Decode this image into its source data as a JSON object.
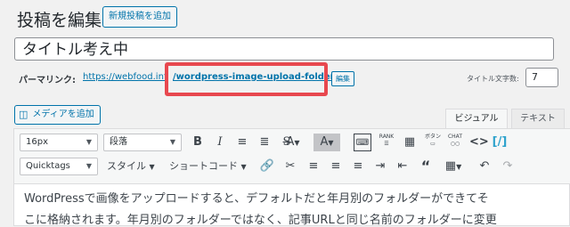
{
  "header": {
    "title": "投稿を編集",
    "add_new_label": "新規投稿を追加"
  },
  "post": {
    "title_value": "タイトル考え中"
  },
  "permalink": {
    "label": "パーマリンク:",
    "base_url": "https://webfood.inf",
    "slug": "/wordpress-image-upload-folder/",
    "edit_label": "編集",
    "highlight_color": "#e8484f"
  },
  "title_counter": {
    "label": "タイトル文字数:",
    "value": "7"
  },
  "media": {
    "add_media_label": "メディアを追加"
  },
  "editor_tabs": {
    "visual": "ビジュアル",
    "text": "テキスト"
  },
  "toolbar_row1": {
    "font_size": "16px",
    "paragraph": "段落",
    "ranking_label": "RANK",
    "button_label": "ボタン",
    "chat_label": "CHAT"
  },
  "toolbar_row2": {
    "quicktags": "Quicktags",
    "style": "スタイル",
    "shortcode": "ショートコード"
  },
  "content": {
    "line1": "WordPressで画像をアップロードすると、デフォルトだと年月別のフォルダーができてそ",
    "line2": "こに格納されます。年月別のフォルダーではなく、記事URLと同じ名前のフォルダーに変更"
  },
  "colors": {
    "accent": "#0073aa",
    "highlight": "#e8484f"
  }
}
